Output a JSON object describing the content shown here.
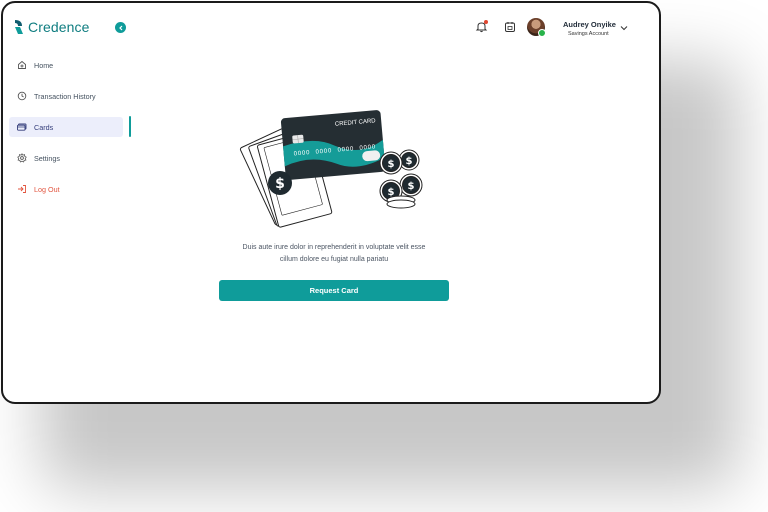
{
  "app": {
    "name": "Credence",
    "brand_color": "#0f9c9a"
  },
  "topbar": {
    "icons": [
      "notification-bell-icon",
      "calendar-icon"
    ],
    "user": {
      "name": "Audrey Onyike",
      "account_type": "Savings Account",
      "online_color": "#28b34a"
    }
  },
  "sidebar": {
    "items": [
      {
        "label": "Home",
        "icon": "home-icon",
        "active": false
      },
      {
        "label": "Transaction History",
        "icon": "history-icon",
        "active": false
      },
      {
        "label": "Cards",
        "icon": "cards-icon",
        "active": true
      },
      {
        "label": "Settings",
        "icon": "gear-icon",
        "active": false
      },
      {
        "label": "Log Out",
        "icon": "logout-icon",
        "active": false
      }
    ]
  },
  "main": {
    "illustration": {
      "card_label": "CREDIT CARD",
      "card_number": [
        "0000",
        "0000",
        "0000",
        "0000"
      ]
    },
    "description_line1": "Duis aute irure dolor in reprehenderit in voluptate velit esse",
    "description_line2": "cillum dolore eu fugiat nulla pariatu",
    "cta_label": "Request Card"
  }
}
